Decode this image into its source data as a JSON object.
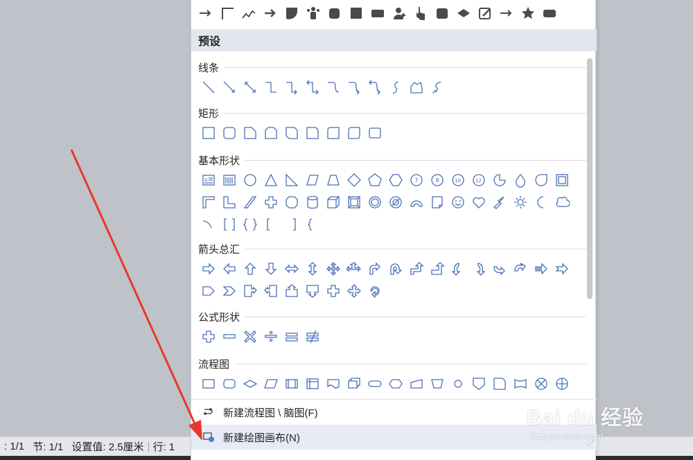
{
  "status_bar": {
    "page": ": 1/1",
    "section": "节: 1/1",
    "setting": "设置值: 2.5厘米",
    "row": "行: 1"
  },
  "shape_panel": {
    "recent_icons": [
      "arrow-right",
      "elbow-connector",
      "freeform-line",
      "block-arrow-right",
      "flowchart-delay",
      "people-group",
      "rounded-square",
      "square",
      "rectangle",
      "person-add",
      "hand-pointer",
      "rounded-rectangle",
      "flowchart-decision",
      "edit-box",
      "arrow-right",
      "star",
      "rounded-rectangle"
    ],
    "preset_header": "预设",
    "categories": [
      {
        "name": "线条",
        "count": 12
      },
      {
        "name": "矩形",
        "count": 9
      },
      {
        "name": "基本形状",
        "count": 42
      },
      {
        "name": "箭头总汇",
        "count": 27
      },
      {
        "name": "公式形状",
        "count": 6
      },
      {
        "name": "流程图",
        "count": 18
      }
    ],
    "bottom_menu": [
      {
        "label": "新建流程图 \\ 脑图(F)",
        "icon": "flowchart-link-icon",
        "active": false
      },
      {
        "label": "新建绘图画布(N)",
        "icon": "canvas-icon",
        "active": true
      }
    ]
  },
  "colors": {
    "shape_stroke": "#4a6fb5",
    "annotation_arrow": "#e8372c",
    "panel_header_bg": "#e3e6ee",
    "active_item_bg": "#e6ebf6"
  },
  "watermark": {
    "brand": "Bai du 经验",
    "url": "jingyan.baidu.com"
  }
}
